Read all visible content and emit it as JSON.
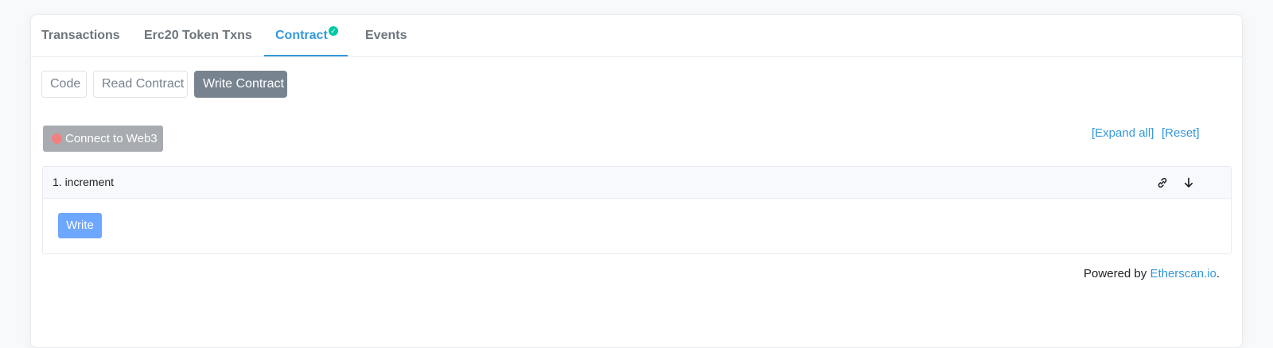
{
  "tabs": [
    {
      "label": "Transactions"
    },
    {
      "label": "Erc20 Token Txns"
    },
    {
      "label": "Contract",
      "verified": true
    },
    {
      "label": "Events"
    }
  ],
  "active_tab": "Contract",
  "subtabs": [
    {
      "label": "Code"
    },
    {
      "label": "Read Contract"
    },
    {
      "label": "Write Contract"
    }
  ],
  "active_subtab": "Write Contract",
  "connect": {
    "label": "Connect to Web3",
    "status_color": "#f08080"
  },
  "links": {
    "expand_all": "[Expand all]",
    "reset": "[Reset]"
  },
  "functions": [
    {
      "title": "1. increment",
      "action_label": "Write"
    }
  ],
  "footer": {
    "prefix": "Powered by ",
    "link": "Etherscan.io",
    "suffix": "."
  },
  "colors": {
    "accent": "#3498db",
    "verified": "#00c9a7",
    "write_button": "#6ea7ff",
    "active_subtab": "#77838f"
  },
  "icons": {
    "verified": "check-circle-icon",
    "status": "dot-icon",
    "link": "link-icon",
    "toggle": "arrow-down-icon"
  }
}
